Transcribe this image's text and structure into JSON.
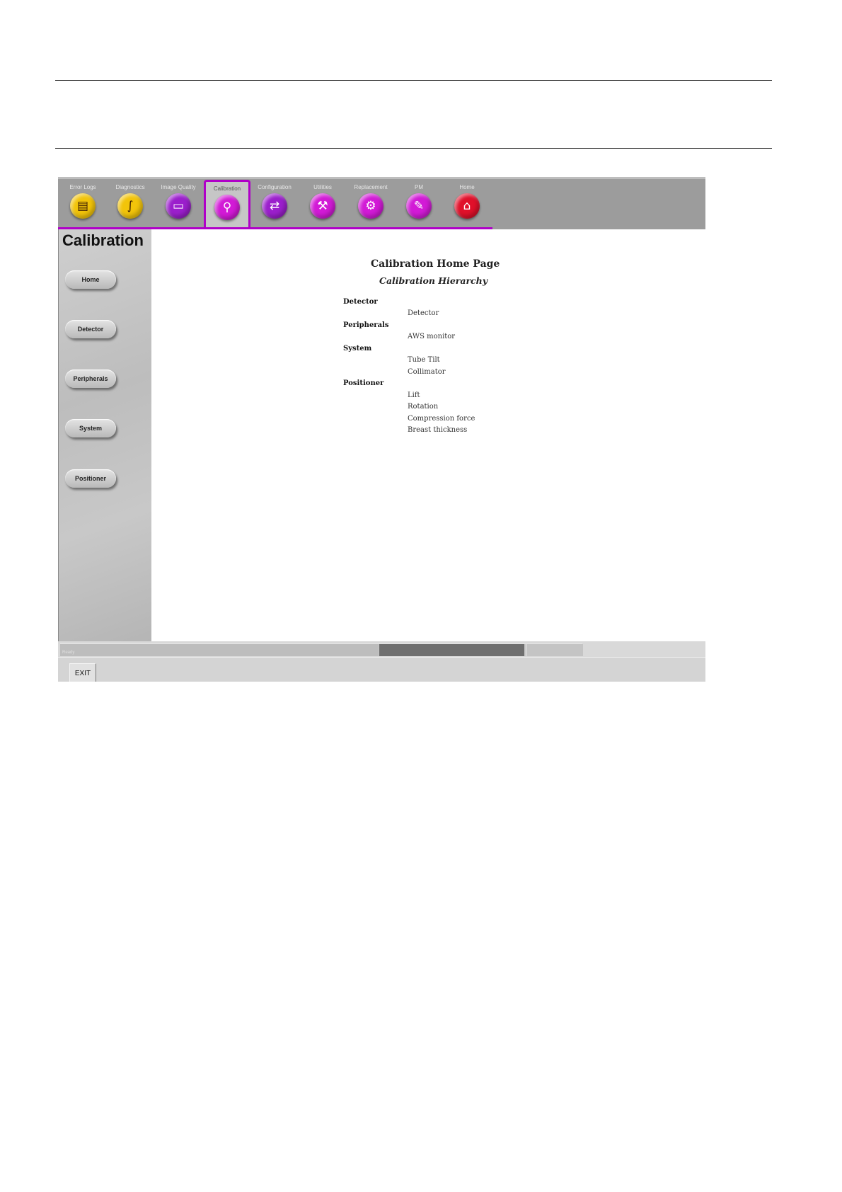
{
  "toolbar": {
    "items": [
      {
        "label": "Error Logs",
        "icon": "logbook-icon"
      },
      {
        "label": "Diagnostics",
        "icon": "stethoscope-icon"
      },
      {
        "label": "Image Quality",
        "icon": "monitor-icon"
      },
      {
        "label": "Calibration",
        "icon": "calibration-icon",
        "active": true
      },
      {
        "label": "Configuration",
        "icon": "configuration-icon"
      },
      {
        "label": "Utilities",
        "icon": "utilities-icon"
      },
      {
        "label": "Replacement",
        "icon": "replacement-icon"
      },
      {
        "label": "PM",
        "icon": "pm-icon"
      },
      {
        "label": "Home",
        "icon": "home-icon"
      }
    ],
    "active_color": "#b000c8"
  },
  "sidebar": {
    "title": "Calibration",
    "buttons": [
      "Home",
      "Detector",
      "Peripherals",
      "System",
      "Positioner"
    ]
  },
  "main": {
    "title": "Calibration Home Page",
    "subtitle": "Calibration Hierarchy",
    "hierarchy": [
      {
        "category": "Detector",
        "items": [
          "Detector"
        ]
      },
      {
        "category": "Peripherals",
        "items": [
          "AWS monitor"
        ]
      },
      {
        "category": "System",
        "items": [
          "Tube Tilt",
          "Collimator"
        ]
      },
      {
        "category": "Positioner",
        "items": [
          "Lift",
          "Rotation",
          "Compression force",
          "Breast thickness"
        ]
      }
    ]
  },
  "statusbar": {
    "text": "Ready"
  },
  "footer": {
    "exit_label": "EXIT"
  }
}
